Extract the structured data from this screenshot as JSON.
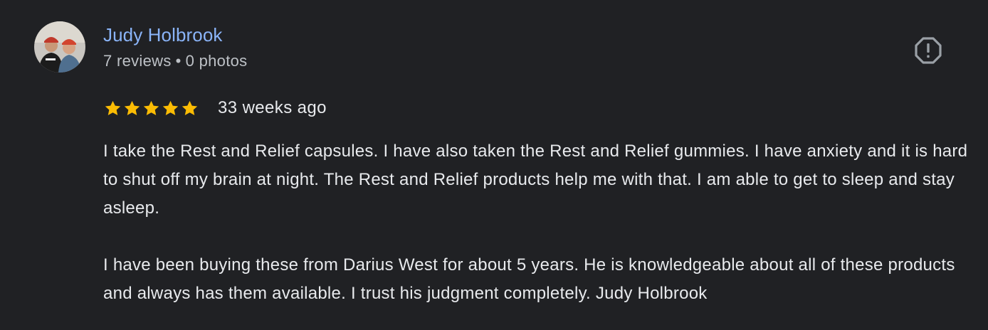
{
  "author": {
    "name": "Judy Holbrook",
    "reviews": "7 reviews",
    "separator": "•",
    "photos": "0 photos",
    "avatar_icon": "profile-photo"
  },
  "review": {
    "rating": 5,
    "rating_max": 5,
    "time_ago": "33 weeks ago",
    "paragraphs": [
      "I take the Rest and Relief capsules. I have also taken the Rest and Relief gummies. I have anxiety and it is hard to shut off my brain at night. The Rest and Relief products help me with that. I am able to get to sleep and stay asleep.",
      "I have been buying these from Darius West for about 5 years. He is knowledgeable about all of these products and always has them available. I trust his judgment completely. Judy Holbrook"
    ]
  },
  "actions": {
    "report_icon": "report-icon"
  },
  "colors": {
    "background": "#202124",
    "author_link": "#8ab4f8",
    "star": "#fbbc04",
    "text": "#e8eaed",
    "meta": "#bdc1c6",
    "icon": "#9aa0a6"
  }
}
